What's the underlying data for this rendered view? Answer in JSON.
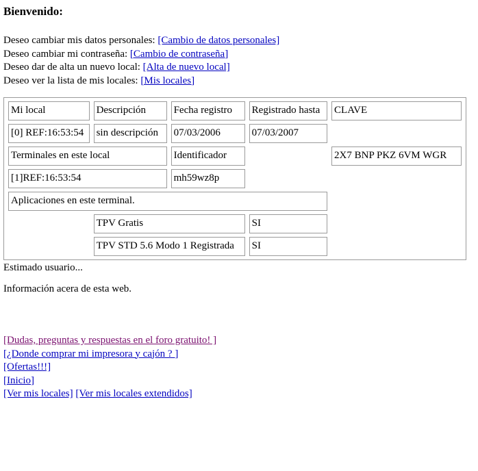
{
  "page": {
    "heading": "Bienvenido:"
  },
  "actions": [
    {
      "prompt": "Deseo cambiar mis datos personales:",
      "link": "[Cambio de datos personales]",
      "name": "cambio-datos-personales"
    },
    {
      "prompt": "Deseo cambiar mi contraseña:",
      "link": "[Cambio de contraseña]",
      "name": "cambio-contrasena"
    },
    {
      "prompt": "Deseo dar de alta un nuevo local:",
      "link": "[Alta de nuevo local]",
      "name": "alta-nuevo-local"
    },
    {
      "prompt": "Deseo ver la lista de mis locales:",
      "link": "[Mis locales]",
      "name": "mis-locales"
    }
  ],
  "local_table": {
    "headers": {
      "mi_local": "Mi local",
      "descripcion": "Descripción",
      "fecha_registro": "Fecha registro",
      "registrado_hasta": "Registrado hasta",
      "clave": "CLAVE"
    },
    "local_row": {
      "nombre": "[0] REF:16:53:54",
      "descripcion": "sin descripción",
      "fecha_registro": "07/03/2006",
      "registrado_hasta": "07/03/2007"
    },
    "terminales_header": {
      "titulo": "Terminales en este local",
      "identificador": "Identificador",
      "clave_valor": "2X7 BNP PKZ 6VM WGR"
    },
    "terminal_row": {
      "nombre": "[1]REF:16:53:54",
      "identificador": "mh59wz8p"
    },
    "aplicaciones_header": "Aplicaciones en este terminal.",
    "aplicaciones": [
      {
        "nombre": "TPV Gratis",
        "estado": "SI"
      },
      {
        "nombre": "TPV STD 5.6 Modo 1 Registrada",
        "estado": "SI"
      }
    ]
  },
  "tail": {
    "greeting": "Estimado usuario...",
    "info": "Información acera de esta web."
  },
  "footer_links": {
    "foro": "[Dudas, preguntas y respuestas en el foro gratuito! ]",
    "donde_comprar": "[¿Donde comprar mi impresora y cajón ? ]",
    "ofertas": "[Ofertas!!!]",
    "inicio": "[Inicio]",
    "ver_locales": "[Ver mis locales]",
    "ver_locales_extendidos": "[Ver mis locales extendidos]"
  },
  "colors": {
    "link": "#0000bf",
    "link_visited": "#7a0f6e",
    "border": "#9a9a9a"
  }
}
